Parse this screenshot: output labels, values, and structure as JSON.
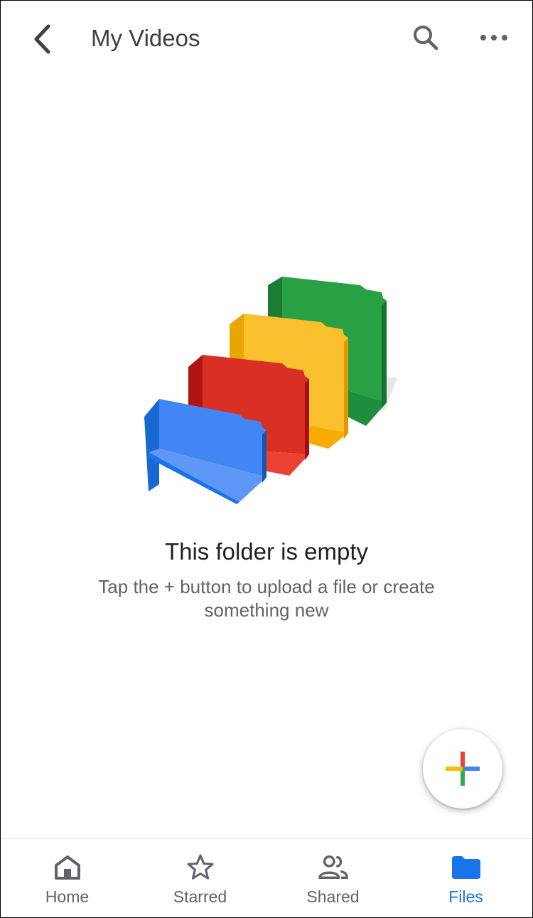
{
  "header": {
    "title": "My Videos",
    "back_icon": "chevron-left-icon",
    "search_icon": "search-icon",
    "more_icon": "more-horizontal-icon"
  },
  "empty_state": {
    "title": "This folder is empty",
    "subtitle": "Tap the + button to upload a file or create something new",
    "illustration": "colored-folders-illustration"
  },
  "fab": {
    "icon": "plus-icon",
    "colors": [
      "#ea4335",
      "#4285f4",
      "#34a853",
      "#fbbc04"
    ]
  },
  "bottom_nav": {
    "active": "Files",
    "active_color": "#1a73e8",
    "items": [
      {
        "label": "Home",
        "icon": "home-icon"
      },
      {
        "label": "Starred",
        "icon": "star-icon"
      },
      {
        "label": "Shared",
        "icon": "people-icon"
      },
      {
        "label": "Files",
        "icon": "folder-icon"
      }
    ]
  }
}
